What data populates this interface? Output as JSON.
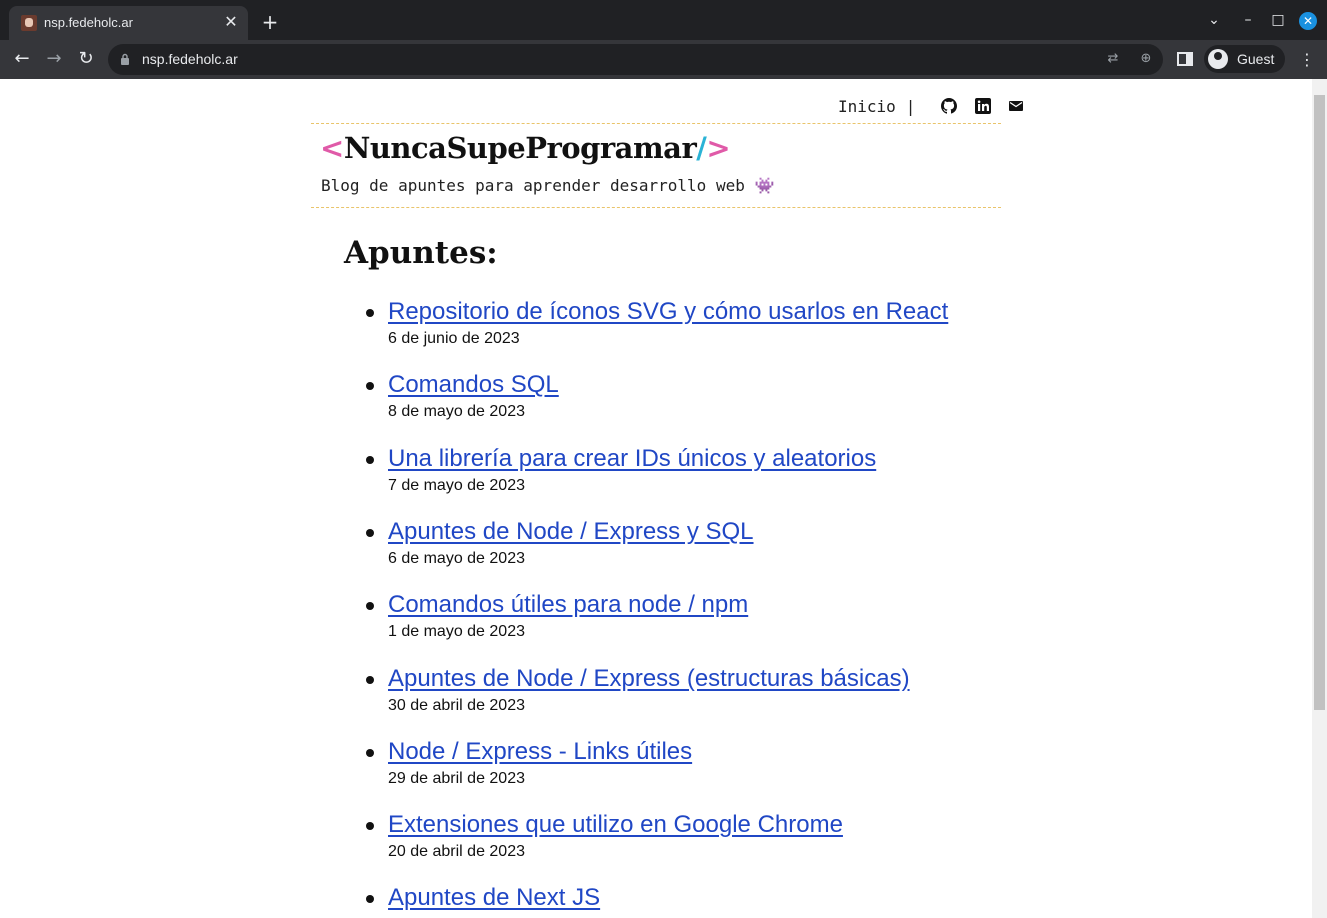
{
  "browser": {
    "tab_title": "nsp.fedeholc.ar",
    "url": "nsp.fedeholc.ar",
    "profile_label": "Guest"
  },
  "site": {
    "nav": {
      "home": "Inicio",
      "separator": "|"
    },
    "brand": {
      "open": "<",
      "name": "NuncaSupeProgramar",
      "slash": "/",
      "close": ">"
    },
    "tagline": "Blog de apuntes para aprender desarrollo web 👾",
    "heading": "Apuntes:"
  },
  "posts": [
    {
      "title": "Repositorio de íconos SVG y cómo usarlos en React",
      "date": "6 de junio de 2023"
    },
    {
      "title": "Comandos SQL",
      "date": "8 de mayo de 2023"
    },
    {
      "title": "Una librería para crear IDs únicos y aleatorios",
      "date": "7 de mayo de 2023"
    },
    {
      "title": "Apuntes de Node / Express y SQL",
      "date": "6 de mayo de 2023"
    },
    {
      "title": "Comandos útiles para node / npm",
      "date": "1 de mayo de 2023"
    },
    {
      "title": "Apuntes de Node / Express (estructuras básicas)",
      "date": "30 de abril de 2023"
    },
    {
      "title": "Node / Express - Links útiles",
      "date": "29 de abril de 2023"
    },
    {
      "title": "Extensiones que utilizo en Google Chrome",
      "date": "20 de abril de 2023"
    },
    {
      "title": "Apuntes de Next JS",
      "date": ""
    }
  ],
  "colors": {
    "link": "#2047c5",
    "brand_pink": "#e05aa8",
    "brand_cyan": "#2bb3d6",
    "divider": "#e9c46a"
  }
}
